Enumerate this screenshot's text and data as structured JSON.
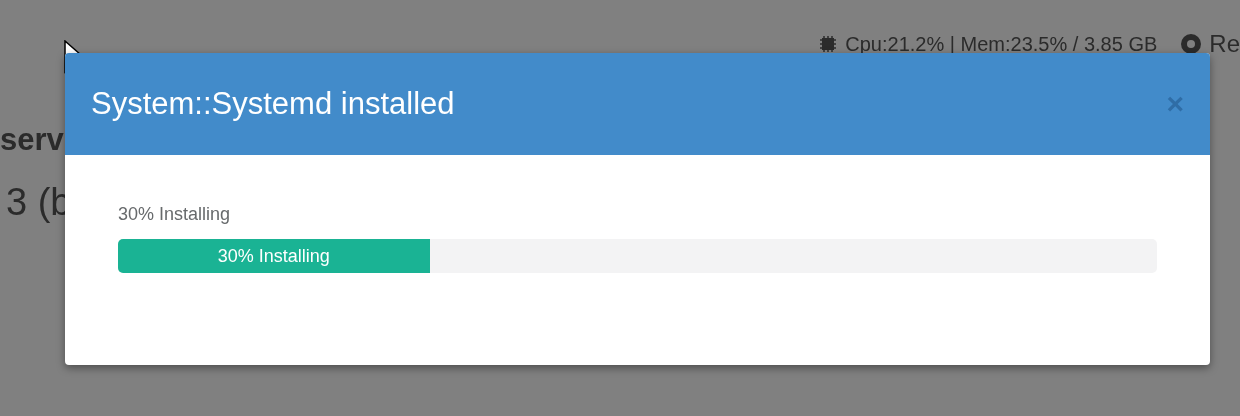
{
  "background": {
    "status": "Cpu:21.2% | Mem:23.5% / 3.85 GB",
    "status_link": "Re",
    "heading": "serv",
    "subheading": "3 (b"
  },
  "modal": {
    "title": "System::Systemd installed",
    "close": "×",
    "progress_label": "30% Installing",
    "progress": {
      "level": 0.3,
      "label": "30% Installing"
    }
  }
}
